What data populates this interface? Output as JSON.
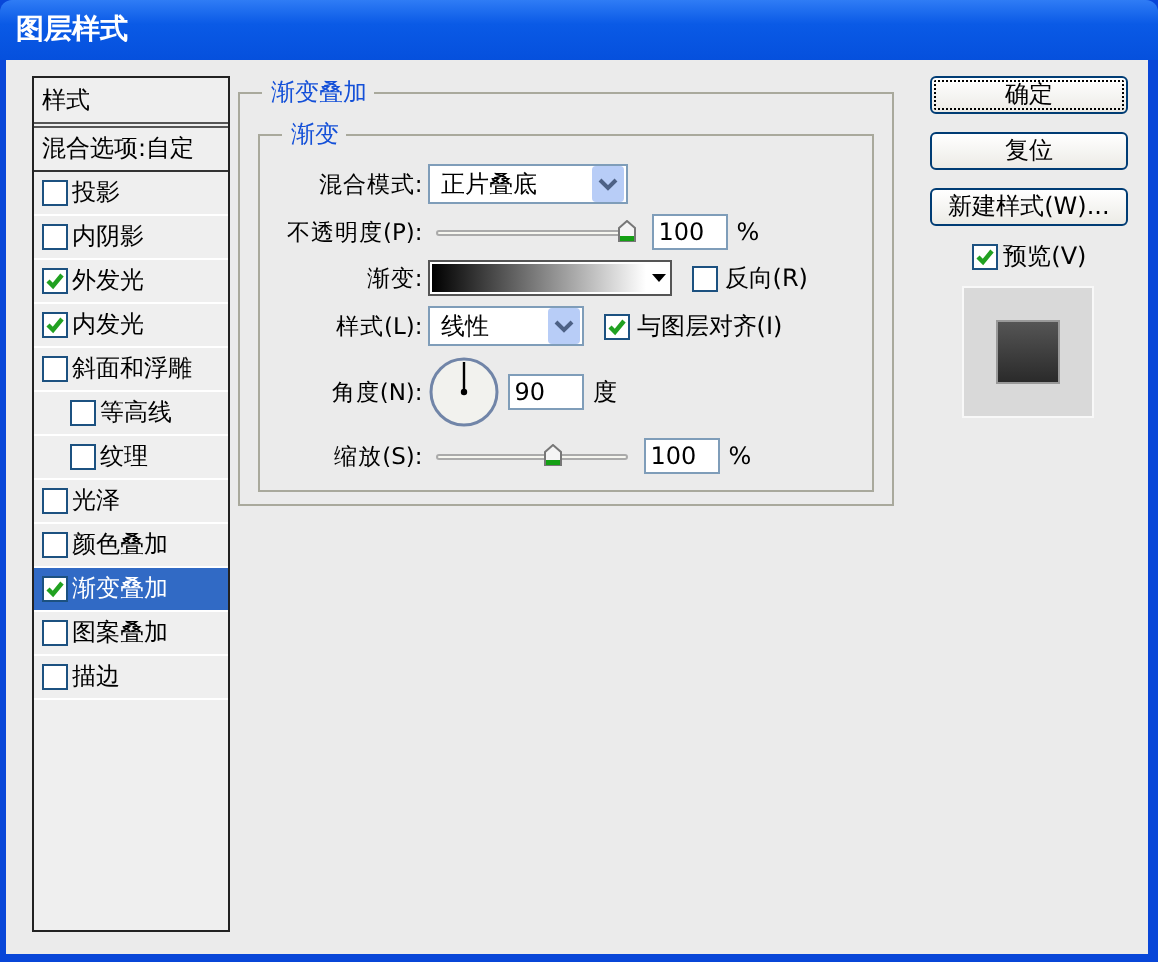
{
  "window": {
    "title": "图层样式"
  },
  "styles_panel": {
    "header": "样式",
    "blend_options": "混合选项:自定",
    "items": [
      {
        "label": "投影",
        "checked": false,
        "selected": false
      },
      {
        "label": "内阴影",
        "checked": false,
        "selected": false
      },
      {
        "label": "外发光",
        "checked": true,
        "selected": false
      },
      {
        "label": "内发光",
        "checked": true,
        "selected": false
      },
      {
        "label": "斜面和浮雕",
        "checked": false,
        "selected": false,
        "children": [
          {
            "label": "等高线",
            "checked": false,
            "selected": false
          },
          {
            "label": "纹理",
            "checked": false,
            "selected": false
          }
        ]
      },
      {
        "label": "光泽",
        "checked": false,
        "selected": false
      },
      {
        "label": "颜色叠加",
        "checked": false,
        "selected": false
      },
      {
        "label": "渐变叠加",
        "checked": true,
        "selected": true
      },
      {
        "label": "图案叠加",
        "checked": false,
        "selected": false
      },
      {
        "label": "描边",
        "checked": false,
        "selected": false
      }
    ]
  },
  "settings": {
    "group_title": "渐变叠加",
    "subgroup_title": "渐变",
    "fields": [
      {
        "kind": "select",
        "label": "混合模式:",
        "value": "正片叠底"
      },
      {
        "kind": "slider",
        "label": "不透明度(P):",
        "level": 1,
        "value": "100",
        "unit": "%"
      },
      {
        "kind": "gradient",
        "label": "渐变:",
        "option": {
          "label": "反向(R)",
          "checked": false
        }
      },
      {
        "kind": "select",
        "label": "样式(L):",
        "value": "线性",
        "option": {
          "label": "与图层对齐(I)",
          "checked": true
        }
      },
      {
        "kind": "angle",
        "label": "角度(N):",
        "value": "90",
        "unit": "度"
      },
      {
        "kind": "slider",
        "label": "缩放(S):",
        "level": 0.62,
        "value": "100",
        "unit": "%"
      }
    ]
  },
  "buttons": [
    {
      "label": "确定",
      "default": true
    },
    {
      "label": "复位",
      "default": false
    },
    {
      "label": "新建样式(W)...",
      "default": false
    }
  ],
  "preview": {
    "label": "预览(V)",
    "checked": true
  }
}
